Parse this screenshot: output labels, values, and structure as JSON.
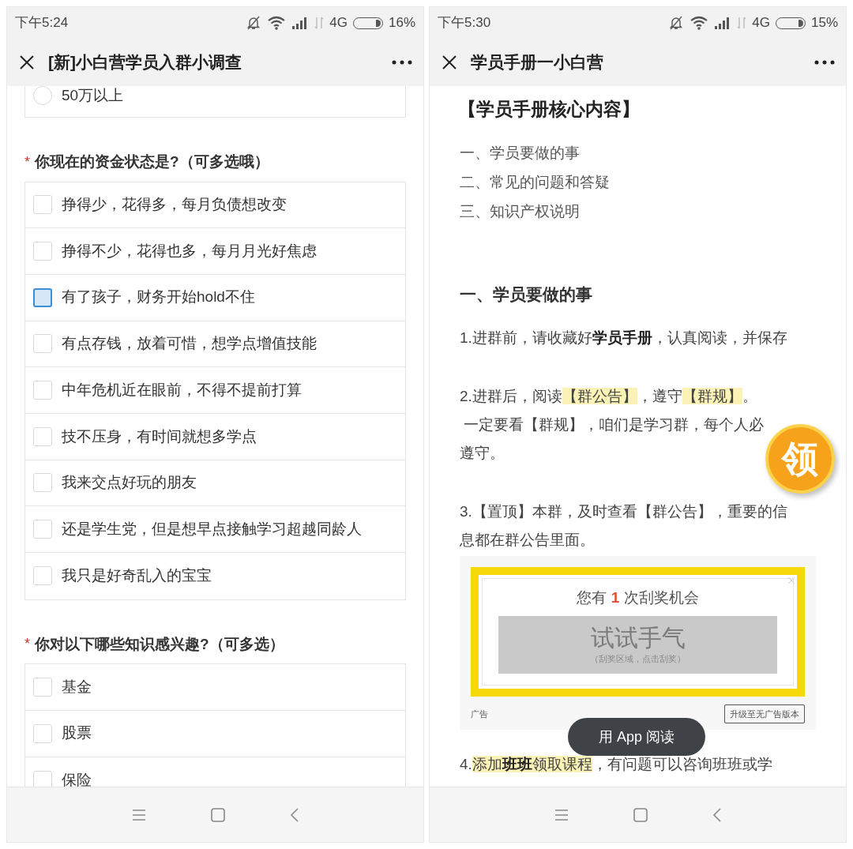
{
  "screens": [
    {
      "status_bar": {
        "time": "下午5:24",
        "network": "4G",
        "battery_percent": "16%"
      },
      "title_bar": {
        "title": "[新]小白营学员入群小调查"
      },
      "form": {
        "partial_option": {
          "text": "50万以上",
          "selected": false
        },
        "questions": [
          {
            "marker": "*",
            "text": "你现在的资金状态是?（可多选哦）",
            "options": [
              {
                "text": "挣得少，花得多，每月负债想改变",
                "checked": false,
                "focused": false
              },
              {
                "text": "挣得不少，花得也多，每月月光好焦虑",
                "checked": false,
                "focused": false
              },
              {
                "text": "有了孩子，财务开始hold不住",
                "checked": false,
                "focused": true
              },
              {
                "text": "有点存钱，放着可惜，想学点增值技能",
                "checked": false,
                "focused": false
              },
              {
                "text": "中年危机近在眼前，不得不提前打算",
                "checked": false,
                "focused": false
              },
              {
                "text": "技不压身，有时间就想多学点",
                "checked": false,
                "focused": false
              },
              {
                "text": "我来交点好玩的朋友",
                "checked": false,
                "focused": false
              },
              {
                "text": "还是学生党，但是想早点接触学习超越同龄人",
                "checked": false,
                "focused": false
              },
              {
                "text": "我只是好奇乱入的宝宝",
                "checked": false,
                "focused": false
              }
            ]
          },
          {
            "marker": "*",
            "text": "你对以下哪些知识感兴趣?（可多选）",
            "options": [
              {
                "text": "基金",
                "checked": false,
                "focused": false
              },
              {
                "text": "股票",
                "checked": false,
                "focused": false
              },
              {
                "text": "保险",
                "checked": false,
                "focused": false
              }
            ]
          }
        ]
      }
    },
    {
      "status_bar": {
        "time": "下午5:30",
        "network": "4G",
        "battery_percent": "15%"
      },
      "title_bar": {
        "title": "学员手册一小白营"
      },
      "article": {
        "blocks": [
          {
            "kind": "heading",
            "text": "【学员手册核心内容】"
          },
          {
            "kind": "toc",
            "text": "一、学员要做的事"
          },
          {
            "kind": "toc",
            "text": "二、常见的问题和答疑"
          },
          {
            "kind": "toc",
            "text": "三、知识产权说明"
          },
          {
            "kind": "section",
            "text": "一、学员要做的事"
          },
          {
            "kind": "para",
            "lines": [
              [
                {
                  "text": "1.进群前，请收藏好",
                  "bold": false,
                  "highlight": false
                },
                {
                  "text": "学员手册",
                  "bold": true,
                  "highlight": false
                },
                {
                  "text": "，认真阅读，并保存",
                  "bold": false,
                  "highlight": false
                }
              ]
            ]
          },
          {
            "kind": "para",
            "lines": [
              [
                {
                  "text": "2.进群后，阅读",
                  "bold": false,
                  "highlight": false
                },
                {
                  "text": "【群公告】",
                  "bold": false,
                  "highlight": true
                },
                {
                  "text": "，遵守",
                  "bold": false,
                  "highlight": false
                },
                {
                  "text": "【群规】",
                  "bold": false,
                  "highlight": true
                },
                {
                  "text": "。",
                  "bold": false,
                  "highlight": false
                }
              ],
              [
                {
                  "text": " 一定要看【群规】，咱们是学习群，每个人必",
                  "bold": false,
                  "highlight": false
                }
              ],
              [
                {
                  "text": "遵守。",
                  "bold": false,
                  "highlight": false
                }
              ]
            ]
          },
          {
            "kind": "para",
            "lines": [
              [
                {
                  "text": "3.【置顶】本群，及时查看【群公告】，重要的信",
                  "bold": false,
                  "highlight": false
                }
              ],
              [
                {
                  "text": "息都在群公告里面。",
                  "bold": false,
                  "highlight": false
                }
              ]
            ]
          },
          {
            "kind": "ad",
            "prompt_before": "您有",
            "count": "1",
            "prompt_after": "次刮奖机会",
            "scratch_title": "试试手气",
            "scratch_hint": "（刮奖区域，点击刮奖）",
            "label": "广告",
            "upgrade_button": "升级至无广告版本"
          },
          {
            "kind": "para",
            "lines": [
              [
                {
                  "text": "4.",
                  "bold": false,
                  "highlight": false
                },
                {
                  "text": "添加",
                  "bold": false,
                  "highlight": true
                },
                {
                  "text": "班班",
                  "bold": true,
                  "highlight": true
                },
                {
                  "text": "领取课程",
                  "bold": false,
                  "highlight": true
                },
                {
                  "text": "，有问题可以咨询班班或学",
                  "bold": false,
                  "highlight": false
                }
              ]
            ]
          }
        ]
      },
      "coin_badge": {
        "text": "领"
      },
      "toast": {
        "text": "用 App 阅读"
      }
    }
  ]
}
